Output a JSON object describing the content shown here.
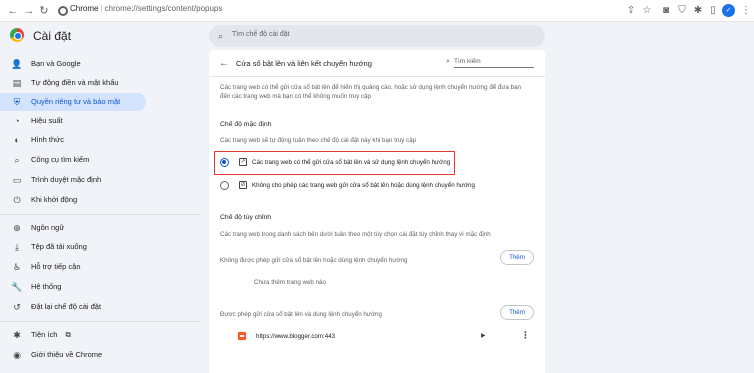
{
  "browser": {
    "site_name": "Chrome",
    "url_path": "chrome://settings/content/popups"
  },
  "header": {
    "app_title": "Cài đặt",
    "search_placeholder": "Tìm chế độ cài đặt"
  },
  "sidebar": {
    "items": [
      {
        "label": "Bạn và Google",
        "icon": "person-icon",
        "glyph": "👤"
      },
      {
        "label": "Tự động điền và mật khẩu",
        "icon": "autofill-icon",
        "glyph": "▤"
      },
      {
        "label": "Quyền riêng tư và bảo mật",
        "icon": "shield-icon",
        "glyph": "⛨"
      },
      {
        "label": "Hiệu suất",
        "icon": "speedometer-icon",
        "glyph": "◔"
      },
      {
        "label": "Hình thức",
        "icon": "palette-icon",
        "glyph": "◐"
      },
      {
        "label": "Công cụ tìm kiếm",
        "icon": "search-icon",
        "glyph": "⌕"
      },
      {
        "label": "Trình duyệt mặc định",
        "icon": "browser-icon",
        "glyph": "▭"
      },
      {
        "label": "Khi khởi động",
        "icon": "power-icon",
        "glyph": "⏻"
      },
      {
        "label": "Ngôn ngữ",
        "icon": "globe-icon",
        "glyph": "⊕"
      },
      {
        "label": "Tệp đã tải xuống",
        "icon": "download-icon",
        "glyph": "⤓"
      },
      {
        "label": "Hỗ trợ tiếp cận",
        "icon": "accessibility-icon",
        "glyph": "♿"
      },
      {
        "label": "Hệ thống",
        "icon": "wrench-icon",
        "glyph": "🔧"
      },
      {
        "label": "Đặt lại chế độ cài đặt",
        "icon": "reset-icon",
        "glyph": "↺"
      },
      {
        "label": "Tiện ích",
        "icon": "puzzle-icon",
        "glyph": "✱"
      },
      {
        "label": "Giới thiệu về Chrome",
        "icon": "chrome-icon",
        "glyph": "◉"
      }
    ],
    "active_index": 2
  },
  "card": {
    "title": "Cửa sổ bật lên và liên kết chuyển hướng",
    "search_placeholder": "Tìm kiếm",
    "description_line1": "Các trang web có thể gửi cửa sổ bật lên để hiển thị quảng cáo, hoặc sử dụng lệnh chuyển hướng để đưa bạn",
    "description_line2": "đến các trang web mà bạn có thể không muốn truy cập",
    "default_section": {
      "title": "Chế độ mặc định",
      "subtitle": "Các trang web sẽ tự động tuân theo chế độ cài đặt này khi bạn truy cập",
      "options": [
        {
          "label": "Các trang web có thể gửi cửa sổ bật lên và sử dụng lệnh chuyển hướng",
          "selected": true
        },
        {
          "label": "Không cho phép các trang web gửi cửa sổ bật lên hoặc dùng lệnh chuyển hướng",
          "selected": false
        }
      ]
    },
    "custom_section": {
      "title": "Chế độ tùy chỉnh",
      "subtitle": "Các trang web trong danh sách bên dưới tuân theo một tùy chọn cài đặt tùy chỉnh thay vì mặc định",
      "blocked": {
        "label": "Không được phép gửi cửa sổ bật lên hoặc dùng lệnh chuyển hướng",
        "add_button": "Thêm",
        "empty_text": "Chưa thêm trang web nào"
      },
      "allowed": {
        "label": "Được phép gửi cửa sổ bật lên và dùng lệnh chuyển hướng",
        "add_button": "Thêm",
        "sites": [
          "https://www.blogger.com:443"
        ]
      }
    }
  },
  "colors": {
    "accent": "#0b57d0",
    "active_nav_bg": "#d3e3fd",
    "highlight_border": "#e53935"
  }
}
